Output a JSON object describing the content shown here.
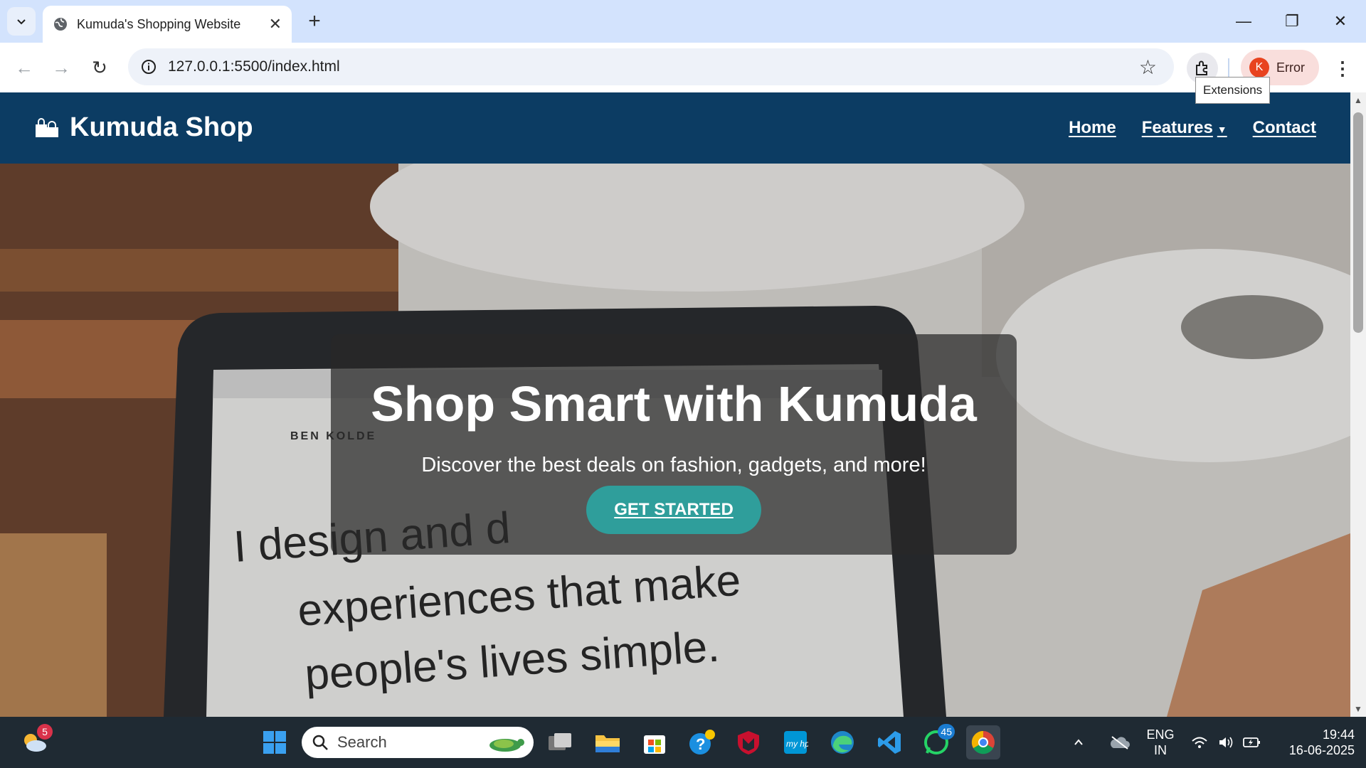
{
  "browser": {
    "tab_title": "Kumuda's Shopping Website",
    "url": "127.0.0.1:5500/index.html",
    "tooltip": "Extensions",
    "profile_initial": "K",
    "profile_status": "Error"
  },
  "site": {
    "brand": "Kumuda Shop",
    "nav": {
      "home": "Home",
      "features": "Features",
      "contact": "Contact"
    },
    "hero": {
      "title": "Shop Smart with Kumuda",
      "subtitle": "Discover the best deals on fashion, gadgets, and more!",
      "cta": "GET STARTED"
    }
  },
  "taskbar": {
    "search_placeholder": "Search",
    "weather_badge": "5",
    "whatsapp_badge": "45",
    "language": "ENG",
    "region": "IN",
    "time": "19:44",
    "date": "16-06-2025"
  },
  "colors": {
    "header_bg": "#0c3c63",
    "cta_bg": "#2f9e9b",
    "tabstrip_bg": "#d3e3fd"
  }
}
